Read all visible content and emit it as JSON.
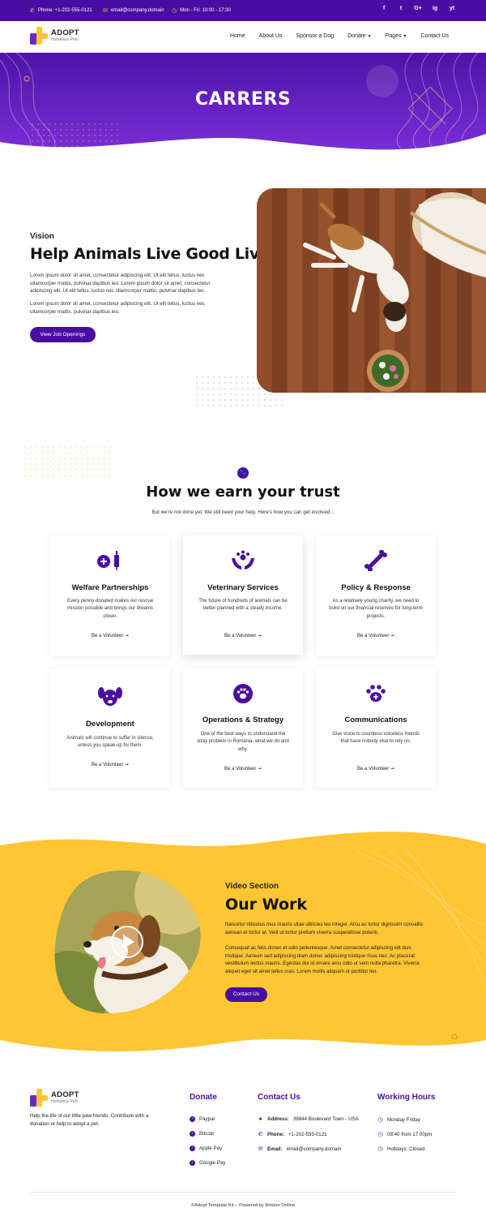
{
  "topbar": {
    "phone": "Phone: +1-202-555-0121",
    "email": "email@company.domain",
    "hours": "Mon - Fri: 10:00 - 17:30",
    "social": [
      "f",
      "t",
      "G+",
      "ig",
      "yt"
    ]
  },
  "brand": {
    "name": "ADOPT",
    "tagline": "Homeless Pets"
  },
  "nav": {
    "items": [
      "Home",
      "About Us",
      "Sponsor a Dog",
      "Donate",
      "Pages",
      "Contact Us"
    ]
  },
  "hero": {
    "title": "CARRERS"
  },
  "vision": {
    "label": "Vision",
    "title": "Help Animals Live Good Lives!",
    "p1": "Lorem ipsum dolor sit amet, consectetur adipiscing elit. Ut elit tellus, luctus nec ullamcorper mattis, pulvinar dapibus leo. Lorem ipsum dolor sit amet, consectetur adipiscing elit. Ut elit tellus, luctus nec ullamcorper mattis, pulvinar dapibus leo.",
    "p2": "Lorem ipsum dolor sit amet, consectetur adipiscing elit. Ut elit tellus, luctus nec ullamcorper mattis, pulvinar dapibus leo.",
    "button": "View Job Openings"
  },
  "trust": {
    "title": "How we earn your trust",
    "subtitle": "But we're not done yet. We still need your help. Here's how you can get involved...",
    "cards": [
      {
        "icon": "medical-syringe-icon",
        "title": "Welfare Partnerships",
        "text": "Every penny donated makes our rescue mission possible and brings our dreams closer.",
        "link": "Be a Volunteer ➞"
      },
      {
        "icon": "hands-paw-icon",
        "title": "Veterinary Services",
        "text": "The future of hundreds of animals can be better planned with a steady Income.",
        "link": "Be a Volunteer ➞"
      },
      {
        "icon": "bone-icon",
        "title": "Policy & Response",
        "text": "As a relatively young charity, we need to build on our financial reserves for long-term projects.",
        "link": "Be a Volunteer ➞"
      },
      {
        "icon": "dog-face-icon",
        "title": "Development",
        "text": "Animals will continue to suffer in silence, unless you speak up for them.",
        "link": "Be a Volunteer ➞"
      },
      {
        "icon": "paw-circle-icon",
        "title": "Operations & Strategy",
        "text": "One of the best ways to understand the stray problem in Romania, what we do and why.",
        "link": "Be a Volunteer ➞"
      },
      {
        "icon": "paw-plus-icon",
        "title": "Communications",
        "text": "Give voice to countless voiceless friends that have nobody else to rely on.",
        "link": "Be a Volunteer ➞"
      }
    ]
  },
  "work": {
    "label": "Video Section",
    "title": "Our Work",
    "p1": "Nascetur ridiculus mus mauris vitae ultricies leo integer. Arcu ac tortor dignissim convallis aenean et tortor at. Velit ut tortor pretium viverra suspendisse potenti.",
    "p2": "Consequat ac felis donec et odio pellentesque. Amet consectetur adipiscing elit duis tristique. Aenean sed adipiscing diam donec adipiscing tristique risus nec. Ac placerat vestibulum lectus mauris. Egestas dui id ornare arcu odio ut sem nulla pharetra. Viverra aliquet eget sit amet tellus cras. Lorem mollis aliquam ut porttitor leo.",
    "button": "Contact Us"
  },
  "footer": {
    "about": "Help the life of our little paw friends. Contribute with a donation or help to adopt a pet.",
    "donate_title": "Donate",
    "donate_items": [
      "Paypal",
      "Bitcoin",
      "Apple Pay",
      "Google Pay"
    ],
    "contact_title": "Contact Us",
    "address_label": "Address:",
    "address": "39844 Boulevard Town - USA",
    "phone_label": "Phone:",
    "phone": "+1-202-555-0121",
    "email_label": "Email:",
    "email": "email@company.domain",
    "hours_title": "Working Hours",
    "hours_items": [
      "Monday Friday",
      "08:40 from 17:00pm",
      "Holidays: Closed"
    ],
    "copyright": "©Adopt Template Kit – Powered by Bimber Online"
  },
  "colors": {
    "primary": "#4a0da3",
    "accent": "#ffc533"
  }
}
